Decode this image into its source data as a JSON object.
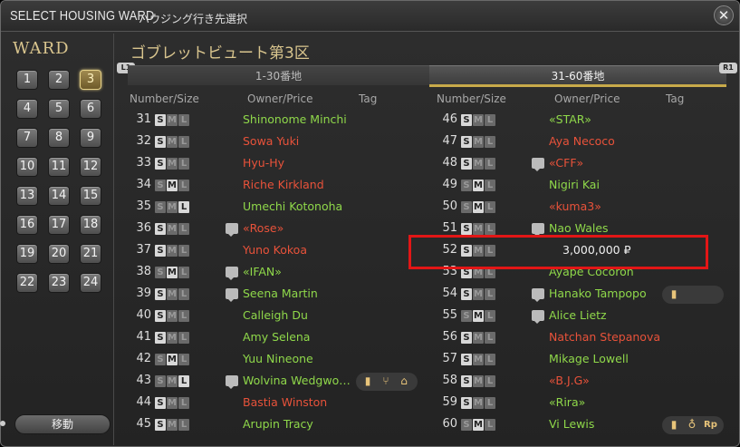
{
  "window": {
    "title": "SELECT HOUSING WARD",
    "subtitle": "ハウジング行き先選択",
    "close_icon": "close-cross-icon"
  },
  "sidebar": {
    "ward_label": "WARD",
    "wards": [
      "1",
      "2",
      "3",
      "4",
      "5",
      "6",
      "7",
      "8",
      "9",
      "10",
      "11",
      "12",
      "13",
      "14",
      "15",
      "16",
      "17",
      "18",
      "19",
      "20",
      "21",
      "22",
      "23",
      "24"
    ],
    "active_ward": "3",
    "move_button": "移動"
  },
  "main": {
    "district_title": "ゴブレットビュート第3区",
    "tabs": [
      {
        "label": "1-30番地",
        "active": false
      },
      {
        "label": "31-60番地",
        "active": true
      }
    ],
    "lb_label": "L1",
    "rb_label": "R1",
    "column_headers": {
      "number_size": "Number/Size",
      "owner_price": "Owner/Price",
      "tag": "Tag"
    }
  },
  "size_letters": {
    "s": "S",
    "m": "M",
    "l": "L"
  },
  "plots_left": [
    {
      "num": "31",
      "size": "S",
      "owner": "Shinonome Minchi",
      "color": "green",
      "chat": false,
      "tags": []
    },
    {
      "num": "32",
      "size": "S",
      "owner": "Sowa Yuki",
      "color": "red",
      "chat": false,
      "tags": []
    },
    {
      "num": "33",
      "size": "S",
      "owner": "Hyu-Hy",
      "color": "red",
      "chat": false,
      "tags": []
    },
    {
      "num": "34",
      "size": "M",
      "owner": "Riche Kirkland",
      "color": "red",
      "chat": false,
      "tags": []
    },
    {
      "num": "35",
      "size": "L",
      "owner": "Umechi Kotonoha",
      "color": "green",
      "chat": false,
      "tags": []
    },
    {
      "num": "36",
      "size": "S",
      "owner": "«Rose»",
      "color": "red",
      "chat": true,
      "tags": []
    },
    {
      "num": "37",
      "size": "S",
      "owner": "Yuno Kokoa",
      "color": "red",
      "chat": false,
      "tags": []
    },
    {
      "num": "38",
      "size": "M",
      "owner": "«IFAN»",
      "color": "green",
      "chat": true,
      "tags": []
    },
    {
      "num": "39",
      "size": "S",
      "owner": "Seena Martin",
      "color": "green",
      "chat": true,
      "tags": []
    },
    {
      "num": "40",
      "size": "S",
      "owner": "Calleigh Du",
      "color": "green",
      "chat": false,
      "tags": []
    },
    {
      "num": "41",
      "size": "S",
      "owner": "Amy Selena",
      "color": "green",
      "chat": false,
      "tags": []
    },
    {
      "num": "42",
      "size": "M",
      "owner": "Yuu Nineone",
      "color": "green",
      "chat": false,
      "tags": []
    },
    {
      "num": "43",
      "size": "L",
      "owner": "Wolvina Wedgwo…",
      "color": "green",
      "chat": true,
      "tags": [
        "door-icon",
        "utensils-icon",
        "shop-icon"
      ]
    },
    {
      "num": "44",
      "size": "S",
      "owner": "Bastia Winston",
      "color": "red",
      "chat": false,
      "tags": []
    },
    {
      "num": "45",
      "size": "S",
      "owner": "Arupin Tracy",
      "color": "green",
      "chat": false,
      "tags": []
    }
  ],
  "plots_right": [
    {
      "num": "46",
      "size": "S",
      "owner": "«STAR»",
      "color": "green",
      "chat": false,
      "tags": []
    },
    {
      "num": "47",
      "size": "S",
      "owner": "Aya Necoco",
      "color": "red",
      "chat": false,
      "tags": []
    },
    {
      "num": "48",
      "size": "S",
      "owner": "«CFF»",
      "color": "red",
      "chat": true,
      "tags": []
    },
    {
      "num": "49",
      "size": "M",
      "owner": "Nigiri Kai",
      "color": "green",
      "chat": false,
      "tags": []
    },
    {
      "num": "50",
      "size": "M",
      "owner": "«kuma3»",
      "color": "red",
      "chat": false,
      "tags": []
    },
    {
      "num": "51",
      "size": "S",
      "owner": "Nao Wales",
      "color": "green",
      "chat": true,
      "tags": []
    },
    {
      "num": "52",
      "size": "S",
      "owner": "",
      "price": "3,000,000 ₽",
      "color": "white",
      "chat": false,
      "tags": []
    },
    {
      "num": "53",
      "size": "S",
      "owner": "Ayape Cocoron",
      "color": "green",
      "chat": false,
      "tags": []
    },
    {
      "num": "54",
      "size": "S",
      "owner": "Hanako Tampopo",
      "color": "green",
      "chat": true,
      "tags": [
        "door-icon"
      ]
    },
    {
      "num": "55",
      "size": "M",
      "owner": "Alice Lietz",
      "color": "green",
      "chat": true,
      "tags": []
    },
    {
      "num": "56",
      "size": "S",
      "owner": "Natchan Stepanova",
      "color": "red",
      "chat": false,
      "tags": []
    },
    {
      "num": "57",
      "size": "S",
      "owner": "Mikage Lowell",
      "color": "green",
      "chat": false,
      "tags": []
    },
    {
      "num": "58",
      "size": "S",
      "owner": "«B.J.G»",
      "color": "red",
      "chat": false,
      "tags": []
    },
    {
      "num": "59",
      "size": "S",
      "owner": "«Rira»",
      "color": "green",
      "chat": false,
      "tags": []
    },
    {
      "num": "60",
      "size": "M",
      "owner": "Vi Lewis",
      "color": "green",
      "chat": false,
      "tags": [
        "door-icon",
        "medal-icon",
        "rp-icon"
      ]
    }
  ],
  "colors": {
    "accent": "#d9c58e",
    "owner_green": "#8fd84a",
    "owner_red": "#e8523a",
    "highlight": "#e21616"
  }
}
